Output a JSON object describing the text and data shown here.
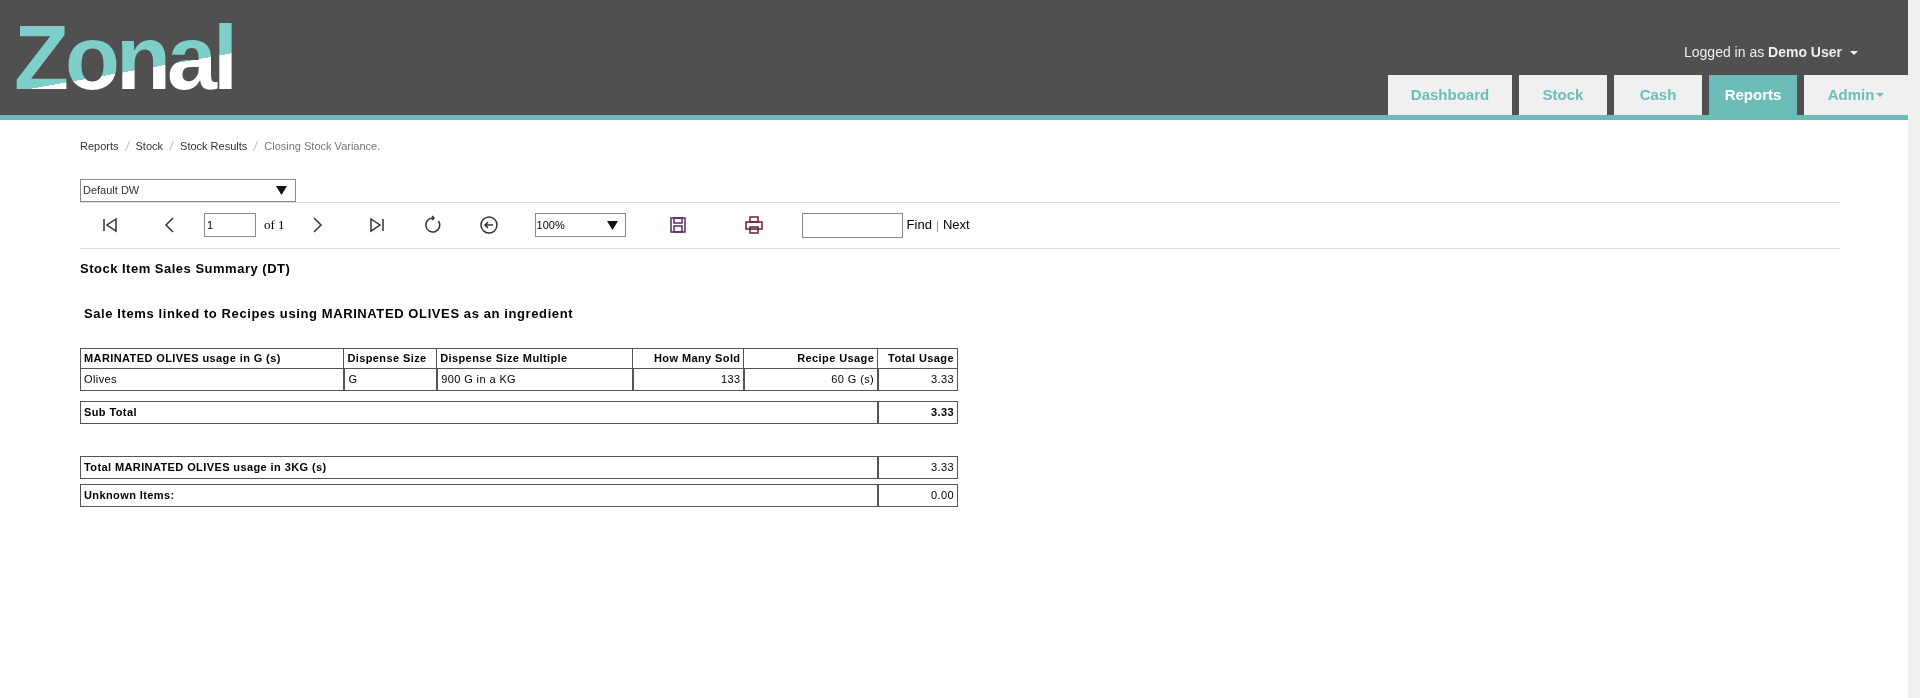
{
  "header": {
    "logo": "Zonal",
    "user_prefix": "Logged in as",
    "user_name": "Demo User"
  },
  "tabs": [
    {
      "label": "Dashboard",
      "selected": false,
      "dropdown": false
    },
    {
      "label": "Stock",
      "selected": false,
      "dropdown": false
    },
    {
      "label": "Cash",
      "selected": false,
      "dropdown": false
    },
    {
      "label": "Reports",
      "selected": true,
      "dropdown": false
    },
    {
      "label": "Admin",
      "selected": false,
      "dropdown": true
    }
  ],
  "breadcrumb": [
    "Reports",
    "Stock",
    "Stock Results",
    "Closing Stock Variance."
  ],
  "report_select": {
    "value": "Default DW"
  },
  "toolbar": {
    "page": "1",
    "of": "of 1",
    "zoom": "100%",
    "find_label": "Find",
    "next_label": "Next"
  },
  "report": {
    "title": "Stock Item Sales Summary (DT)",
    "subtitle": "Sale Items linked to Recipes using MARINATED OLIVES as an ingredient",
    "columns": [
      "MARINATED OLIVES usage in G (s)",
      "Dispense Size",
      "Dispense Size Multiple",
      "How Many Sold",
      "Recipe Usage",
      "Total Usage"
    ],
    "rows": [
      [
        "Olives",
        "G",
        "900 G in a KG",
        "133",
        "60 G (s)",
        "3.33"
      ]
    ],
    "subtotal": {
      "label": "Sub Total",
      "value": "3.33"
    },
    "totals": [
      {
        "label": "Total MARINATED OLIVES usage in 3KG (s)",
        "value": "3.33"
      },
      {
        "label": "Unknown Items:",
        "value": "0.00"
      }
    ]
  }
}
